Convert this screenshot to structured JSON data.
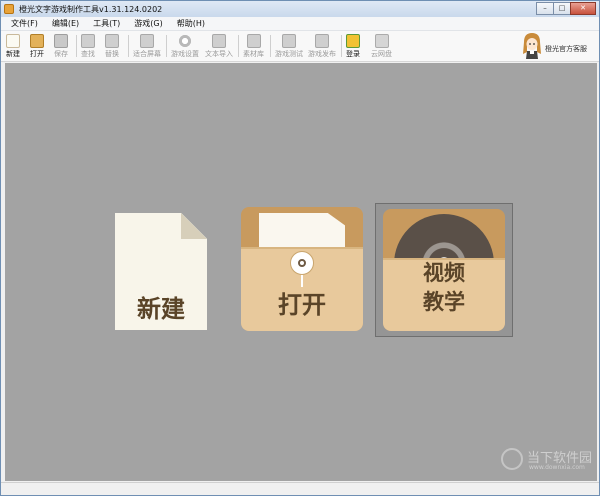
{
  "window": {
    "title": "橙光文字游戏制作工具v1.31.124.0202",
    "controls": {
      "minimize": "–",
      "maximize": "□",
      "close": "✕"
    }
  },
  "menu": [
    "文件(F)",
    "编辑(E)",
    "工具(T)",
    "游戏(G)",
    "帮助(H)"
  ],
  "toolbar": {
    "items": [
      {
        "label": "新建",
        "icon": "new-doc-icon",
        "enabled": true
      },
      {
        "label": "打开",
        "icon": "open-folder-icon",
        "enabled": true
      },
      {
        "label": "保存",
        "icon": "save-icon",
        "enabled": false
      },
      {
        "label": "查找",
        "icon": "find-icon",
        "enabled": false
      },
      {
        "label": "替换",
        "icon": "replace-icon",
        "enabled": false
      },
      {
        "label": "适合屏幕",
        "icon": "fit-screen-icon",
        "enabled": false
      },
      {
        "label": "游戏设置",
        "icon": "gear-icon",
        "enabled": false
      },
      {
        "label": "文本导入",
        "icon": "text-import-icon",
        "enabled": false
      },
      {
        "label": "素材库",
        "icon": "material-library-icon",
        "enabled": false
      },
      {
        "label": "游戏测试",
        "icon": "game-test-icon",
        "enabled": false
      },
      {
        "label": "游戏发布",
        "icon": "game-publish-icon",
        "enabled": false
      },
      {
        "label": "登录",
        "icon": "login-icon",
        "enabled": true
      },
      {
        "label": "云网盘",
        "icon": "cloud-drive-icon",
        "enabled": false
      }
    ],
    "service_label": "橙光官方客服"
  },
  "tiles": {
    "new_label": "新建",
    "open_label": "打开",
    "video_line1": "视频",
    "video_line2": "教学"
  },
  "watermark": {
    "text": "当下软件园",
    "url": "www.downxia.com"
  },
  "colors": {
    "background": "#a3a3a3",
    "tile_brown": "#c89a5e",
    "tile_light": "#e8c99c",
    "paper": "#f8f5ea",
    "label_text": "#5a4428"
  }
}
